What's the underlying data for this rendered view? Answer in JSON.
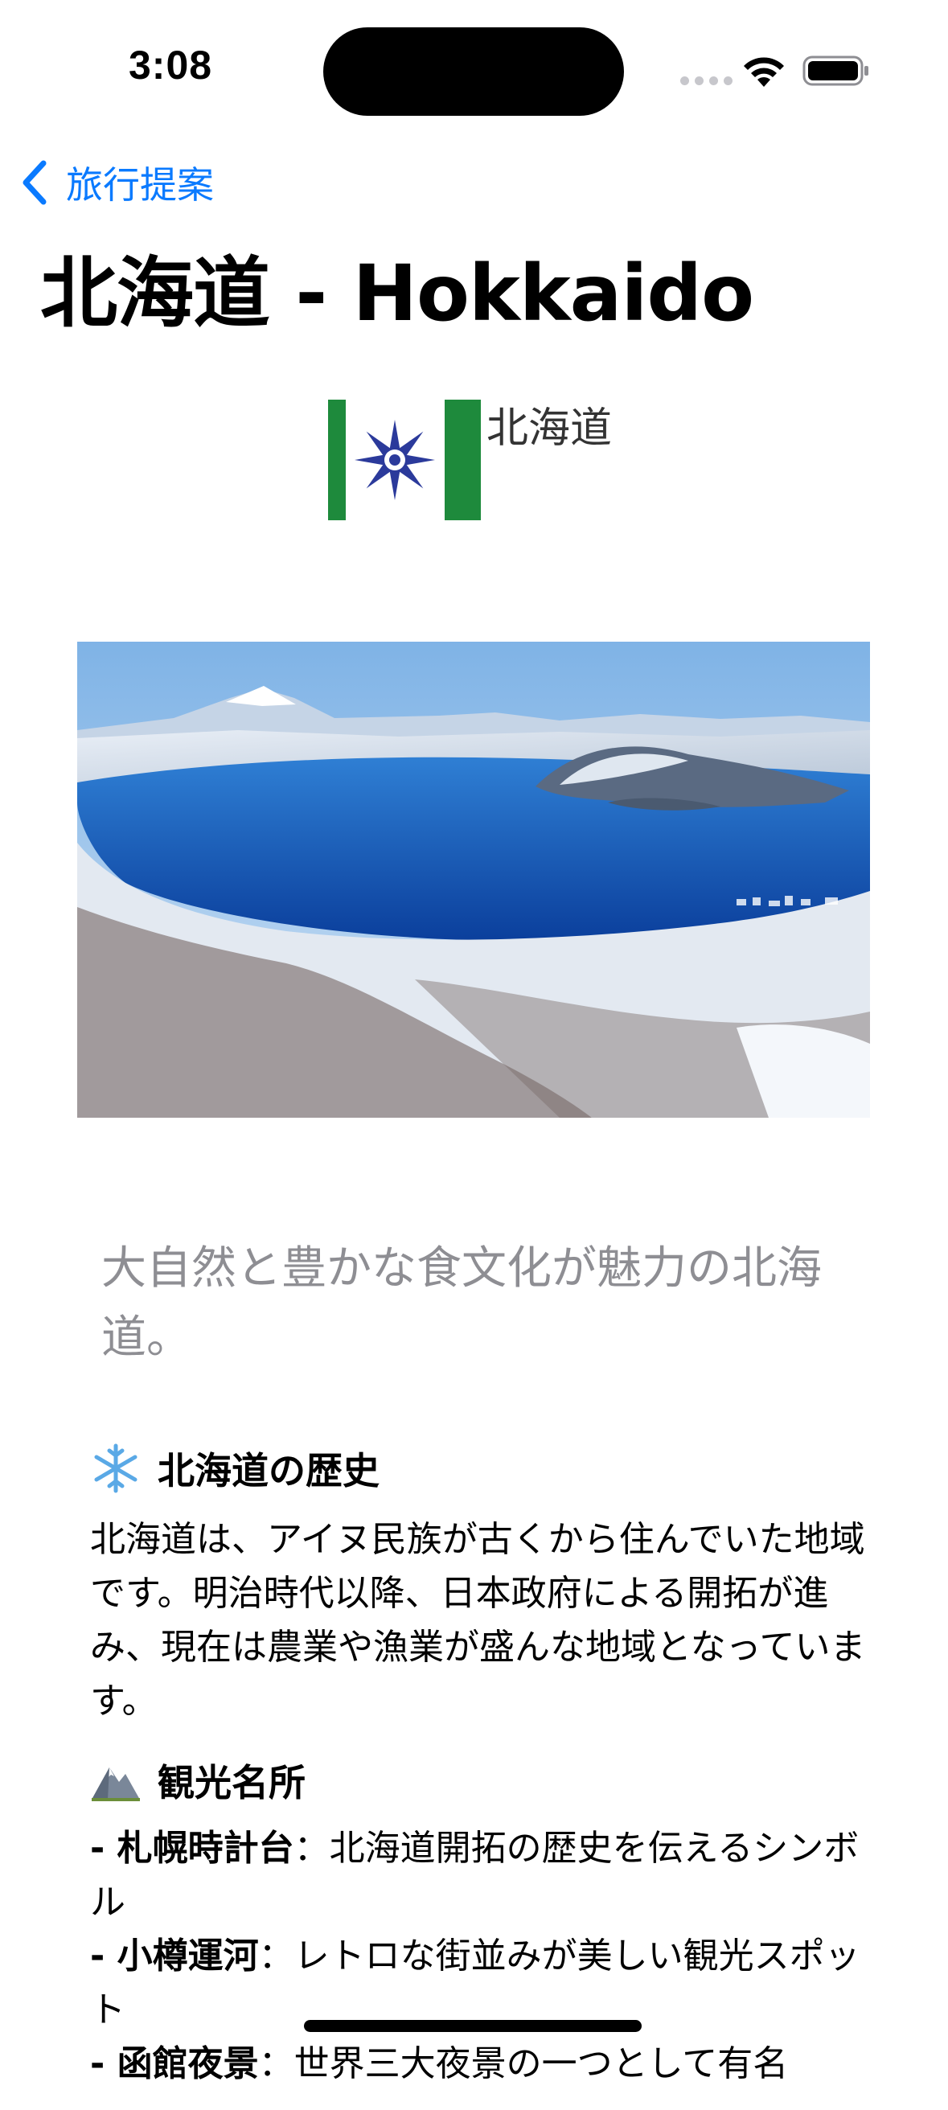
{
  "status_bar": {
    "time": "3:08",
    "icons": [
      "signal-dots-icon",
      "wifi-icon",
      "battery-icon"
    ]
  },
  "nav": {
    "back_label": "旅行提案",
    "back_icon": "chevron-left-icon",
    "accent_color": "#0a7aff"
  },
  "page": {
    "title": "北海道 - Hokkaido",
    "emblem_text": "北海道",
    "photo_alt": "lake-aerial-photo",
    "tagline": "大自然と豊かな食文化が魅力の北海道。"
  },
  "sections": [
    {
      "icon": "snowflake-icon",
      "heading": "北海道の歴史",
      "body": "北海道は、アイヌ民族が古くから住んでいた地域です。明治時代以降、日本政府による開拓が進み、現在は農業や漁業が盛んな地域となっています。"
    },
    {
      "icon": "mountain-icon",
      "heading": "観光名所",
      "items": [
        {
          "prefix": "- ",
          "name": "札幌時計台",
          "sep": "：",
          "desc": "北海道開拓の歴史を伝えるシンボル"
        },
        {
          "prefix": "- ",
          "name": "小樽運河",
          "sep": "：",
          "desc": "レトロな街並みが美しい観光スポット"
        },
        {
          "prefix": "- ",
          "name": "函館夜景",
          "sep": "：",
          "desc": "世界三大夜景の一つとして有名"
        }
      ]
    }
  ]
}
